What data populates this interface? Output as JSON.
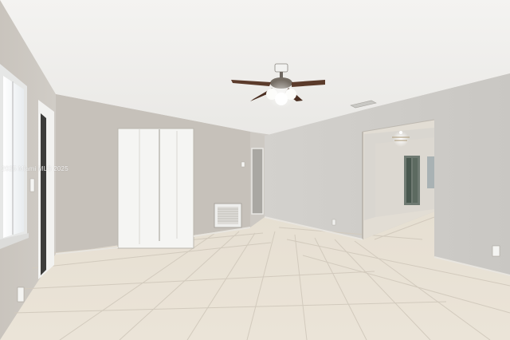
{
  "photo": {
    "subject": "empty room",
    "watermark_text": "2025 Miami MLS 2025"
  },
  "colors": {
    "ceiling": "#f1f0ee",
    "wall": "#cbc7c1",
    "floor": "#e9e2d6",
    "closet_door": "#f4f4f2",
    "grout": "#cfc7b9"
  }
}
